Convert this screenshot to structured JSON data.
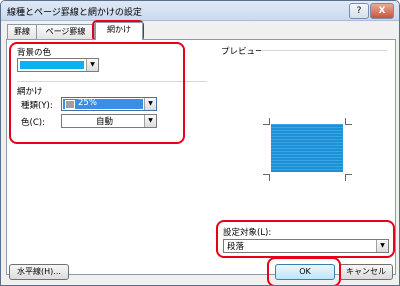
{
  "window": {
    "title": "線種とページ罫線と網かけの設定",
    "help_button": "?",
    "close_button": "X"
  },
  "tabs": [
    {
      "label": "罫線"
    },
    {
      "label": "ページ罫線"
    },
    {
      "label": "網かけ"
    }
  ],
  "background_color": {
    "label": "背景の色",
    "swatch_color": "#0db0f0"
  },
  "shading": {
    "label": "網かけ",
    "type_label": "種類(Y):",
    "type_value": "25%",
    "color_label": "色(C):",
    "color_value": "自動"
  },
  "preview": {
    "label": "プレビュー",
    "preview_fill": "#1e90d8"
  },
  "apply_to": {
    "label": "設定対象(L):",
    "value": "段落"
  },
  "buttons": {
    "horizontal_line": "水平線(H)...",
    "ok": "OK",
    "cancel": "キャンセル"
  },
  "highlight_color": "#e8001a"
}
